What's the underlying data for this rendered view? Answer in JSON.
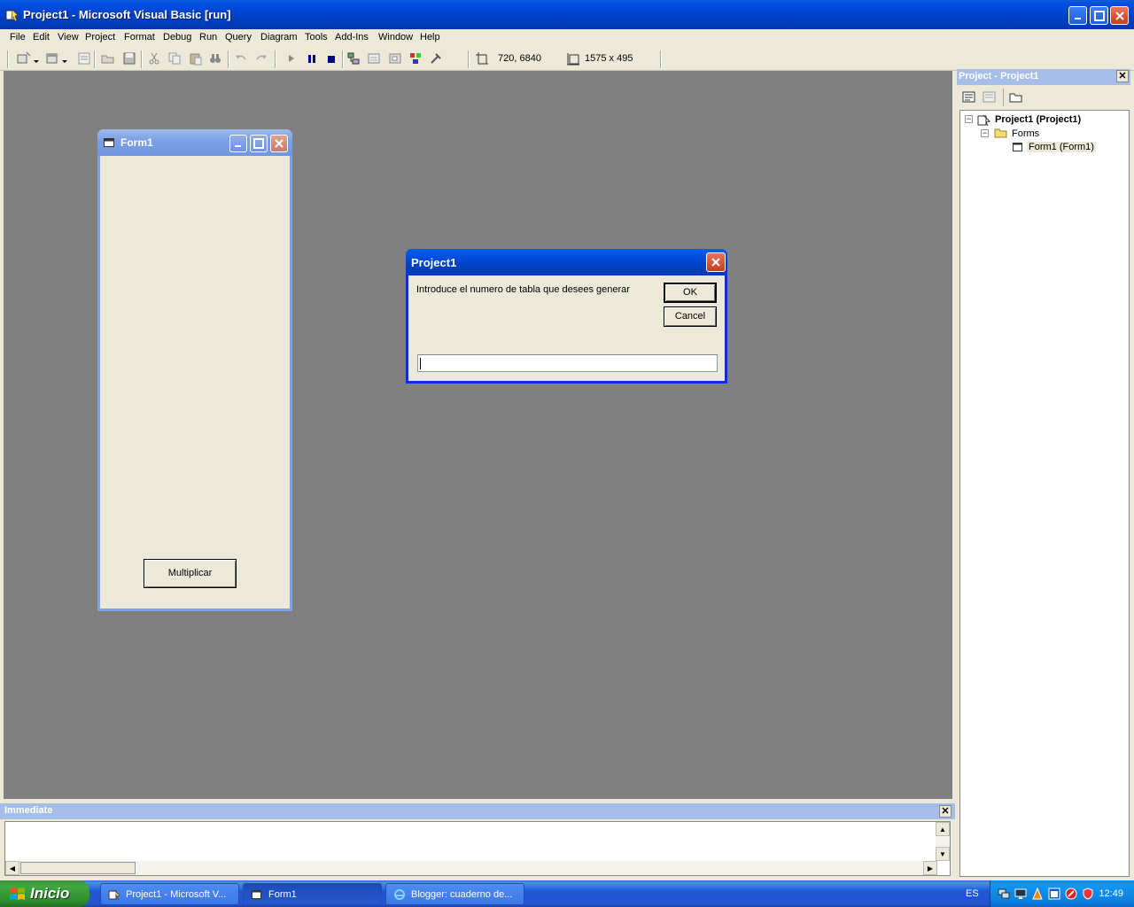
{
  "window": {
    "title": "Project1 - Microsoft Visual Basic [run]"
  },
  "menu": [
    "File",
    "Edit",
    "View",
    "Project",
    "Format",
    "Debug",
    "Run",
    "Query",
    "Diagram",
    "Tools",
    "Add-Ins",
    "Window",
    "Help"
  ],
  "toolbar": {
    "position": "720, 6840",
    "size": "1575 x 495"
  },
  "form1": {
    "title": "Form1",
    "button_label": "Multiplicar"
  },
  "dialog": {
    "title": "Project1",
    "prompt": "Introduce el numero de tabla que desees generar",
    "ok_label": "OK",
    "cancel_label": "Cancel",
    "input_value": ""
  },
  "project_explorer": {
    "title": "Project - Project1",
    "tree": {
      "root": "Project1 (Project1)",
      "folder": "Forms",
      "item": "Form1 (Form1)"
    }
  },
  "immediate": {
    "title": "Immediate"
  },
  "taskbar": {
    "start_label": "Inicio",
    "tasks": [
      "Project1 - Microsoft V...",
      "Form1",
      "Blogger: cuaderno de..."
    ],
    "language": "ES",
    "clock": "12:49"
  },
  "colors": {
    "titlebar": "#0046d5",
    "mdi_background": "#808080",
    "face": "#ece9d8"
  }
}
